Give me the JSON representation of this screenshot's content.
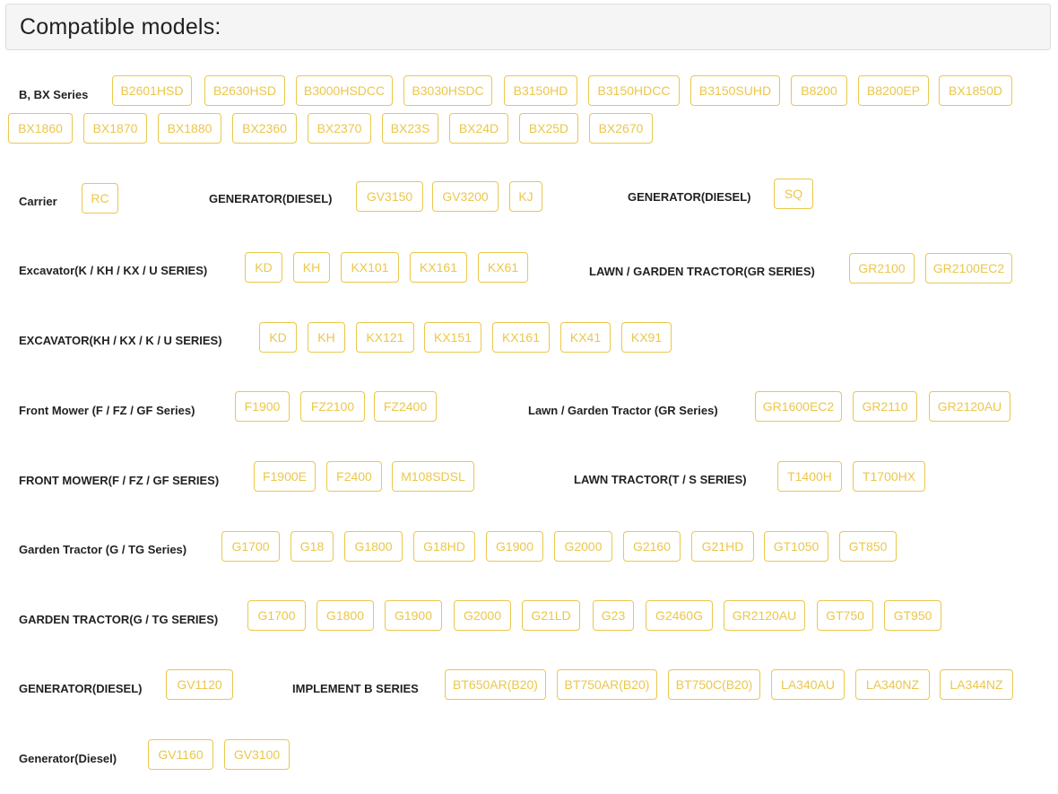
{
  "header": {
    "title": "Compatible models:"
  },
  "labels": {
    "b_bx": "B, BX Series",
    "carrier": "Carrier",
    "gen1": "GENERATOR(DIESEL)",
    "gen2": "GENERATOR(DIESEL)",
    "exc1": "Excavator(K / KH / KX / U SERIES)",
    "lawn1": "LAWN / GARDEN TRACTOR(GR SERIES)",
    "exc2": "EXCAVATOR(KH / KX / K / U SERIES)",
    "front1": "Front Mower (F / FZ / GF Series)",
    "lawn2": "Lawn / Garden Tractor (GR Series)",
    "front2": "FRONT MOWER(F / FZ / GF SERIES)",
    "lawnt": "LAWN TRACTOR(T / S SERIES)",
    "garden1": "Garden Tractor (G / TG Series)",
    "garden2": "GARDEN TRACTOR(G / TG SERIES)",
    "gen3": "GENERATOR(DIESEL)",
    "impl": "IMPLEMENT B SERIES",
    "gen4": "Generator(Diesel)"
  },
  "chips": {
    "b_bx": [
      "B2601HSD",
      "B2630HSD",
      "B3000HSDCC",
      "B3030HSDC",
      "B3150HD",
      "B3150HDCC",
      "B3150SUHD",
      "B8200",
      "B8200EP",
      "BX1850D",
      "BX1860",
      "BX1870",
      "BX1880",
      "BX2360",
      "BX2370",
      "BX23S",
      "BX24D",
      "BX25D",
      "BX2670"
    ],
    "carrier": [
      "RC"
    ],
    "gen1": [
      "GV3150",
      "GV3200",
      "KJ"
    ],
    "gen2": [
      "SQ"
    ],
    "exc1": [
      "KD",
      "KH",
      "KX101",
      "KX161",
      "KX61"
    ],
    "lawn1": [
      "GR2100",
      "GR2100EC2"
    ],
    "exc2": [
      "KD",
      "KH",
      "KX121",
      "KX151",
      "KX161",
      "KX41",
      "KX91"
    ],
    "front1": [
      "F1900",
      "FZ2100",
      "FZ2400"
    ],
    "lawn2": [
      "GR1600EC2",
      "GR2110",
      "GR2120AU"
    ],
    "front2": [
      "F1900E",
      "F2400",
      "M108SDSL"
    ],
    "lawnt": [
      "T1400H",
      "T1700HX"
    ],
    "garden1": [
      "G1700",
      "G18",
      "G1800",
      "G18HD",
      "G1900",
      "G2000",
      "G2160",
      "G21HD",
      "GT1050",
      "GT850"
    ],
    "garden2": [
      "G1700",
      "G1800",
      "G1900",
      "G2000",
      "G21LD",
      "G23",
      "G2460G",
      "GR2120AU",
      "GT750",
      "GT950"
    ],
    "gen3": [
      "GV1120"
    ],
    "impl": [
      "BT650AR(B20)",
      "BT750AR(B20)",
      "BT750C(B20)",
      "LA340AU",
      "LA340NZ",
      "LA344NZ"
    ],
    "gen4": [
      "GV1160",
      "GV3100"
    ]
  }
}
